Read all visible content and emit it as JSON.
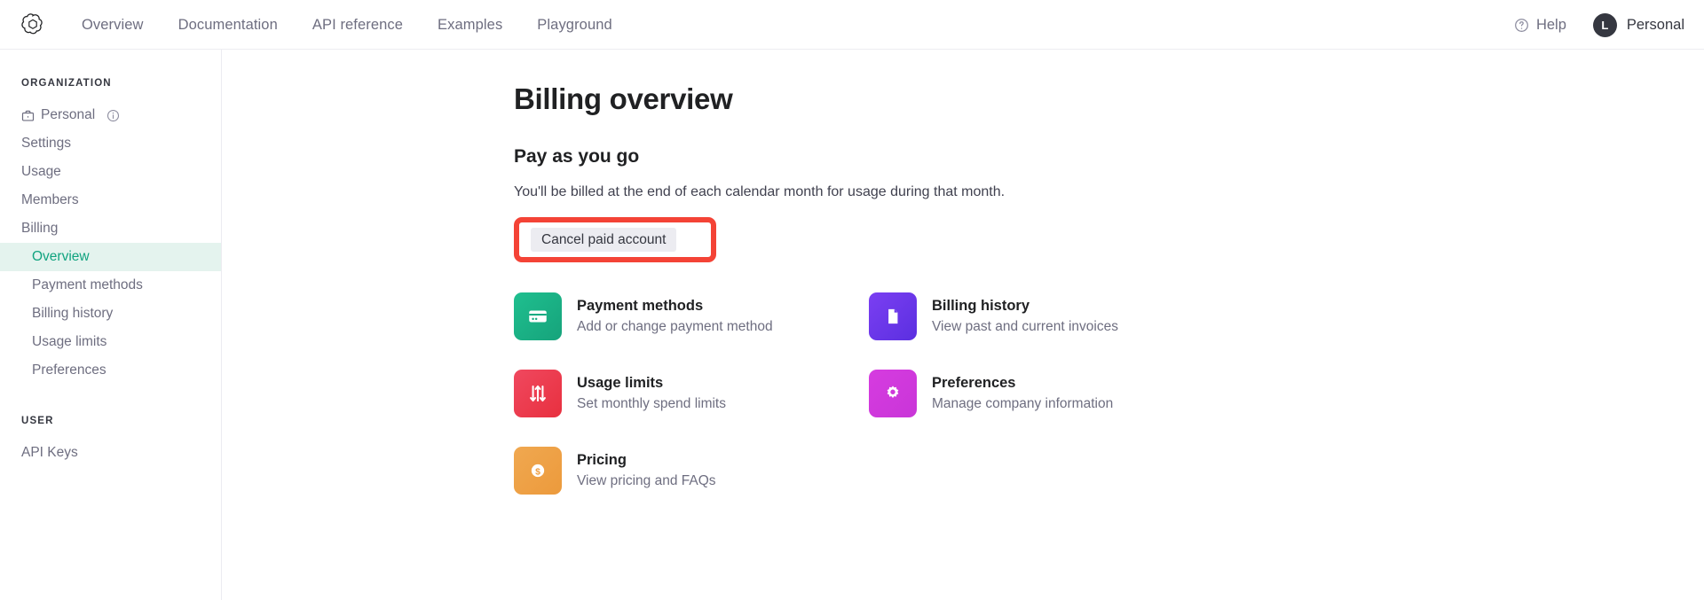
{
  "topbar": {
    "logo_icon": "openai-logo-icon",
    "nav": [
      {
        "label": "Overview"
      },
      {
        "label": "Documentation"
      },
      {
        "label": "API reference"
      },
      {
        "label": "Examples"
      },
      {
        "label": "Playground"
      }
    ],
    "help": {
      "label": "Help",
      "icon": "question-circle-icon"
    },
    "account": {
      "initial": "L",
      "name": "Personal"
    }
  },
  "sidebar": {
    "organization_heading": "ORGANIZATION",
    "org_items": [
      {
        "label": "Personal",
        "icon": "briefcase-icon",
        "trailing_icon": "info-circle-icon",
        "active": false
      },
      {
        "label": "Settings",
        "active": false
      },
      {
        "label": "Usage",
        "active": false
      },
      {
        "label": "Members",
        "active": false
      },
      {
        "label": "Billing",
        "active": false
      }
    ],
    "billing_subitems": [
      {
        "label": "Overview",
        "active": true
      },
      {
        "label": "Payment methods",
        "active": false
      },
      {
        "label": "Billing history",
        "active": false
      },
      {
        "label": "Usage limits",
        "active": false
      },
      {
        "label": "Preferences",
        "active": false
      }
    ],
    "user_heading": "USER",
    "user_items": [
      {
        "label": "API Keys",
        "active": false
      }
    ]
  },
  "main": {
    "page_title": "Billing overview",
    "section_title": "Pay as you go",
    "section_desc": "You'll be billed at the end of each calendar month for usage during that month.",
    "cancel_button": "Cancel paid account",
    "highlight_color": "#f44336",
    "cards": [
      {
        "title": "Payment methods",
        "subtitle": "Add or change payment method",
        "icon": "credit-card-icon",
        "color_from": "#1fbf8f",
        "color_to": "#16a37b"
      },
      {
        "title": "Billing history",
        "subtitle": "View past and current invoices",
        "icon": "document-icon",
        "color_from": "#7b3ff2",
        "color_to": "#5b2fe0"
      },
      {
        "title": "Usage limits",
        "subtitle": "Set monthly spend limits",
        "icon": "sliders-icon",
        "color_from": "#f0485f",
        "color_to": "#e8303f"
      },
      {
        "title": "Preferences",
        "subtitle": "Manage company information",
        "icon": "gear-icon",
        "color_from": "#d63ce0",
        "color_to": "#c935d8"
      },
      {
        "title": "Pricing",
        "subtitle": "View pricing and FAQs",
        "icon": "dollar-circle-icon",
        "color_from": "#f0a850",
        "color_to": "#ec9a3c"
      }
    ]
  }
}
